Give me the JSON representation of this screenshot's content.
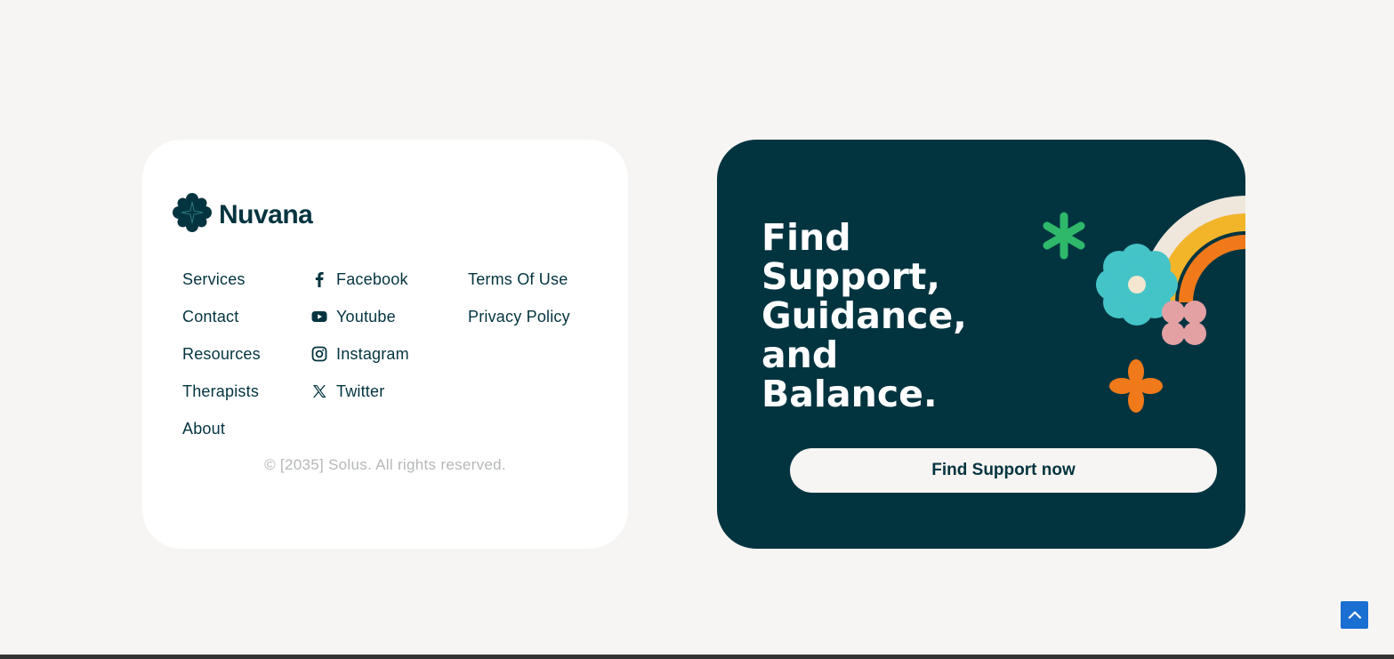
{
  "brand": {
    "name": "Nuvana"
  },
  "nav": {
    "col1": [
      {
        "label": "Services"
      },
      {
        "label": "Contact"
      },
      {
        "label": "Resources"
      },
      {
        "label": "Therapists"
      },
      {
        "label": "About"
      }
    ],
    "col2": [
      {
        "label": "Facebook",
        "icon": "facebook-icon"
      },
      {
        "label": "Youtube",
        "icon": "youtube-icon"
      },
      {
        "label": "Instagram",
        "icon": "instagram-icon"
      },
      {
        "label": "Twitter",
        "icon": "x-twitter-icon"
      }
    ],
    "col3": [
      {
        "label": "Terms Of Use"
      },
      {
        "label": "Privacy Policy"
      }
    ]
  },
  "copyright": "© [2035] Solus. All rights reserved.",
  "cta": {
    "heading_lines": [
      "Find",
      "Support,",
      "Guidance,",
      "and",
      "Balance."
    ],
    "button_label": "Find Support now"
  },
  "colors": {
    "brand_dark": "#023440",
    "page_bg": "#f7f5f3",
    "card_bg": "#ffffff",
    "accent_blue": "#1a6fd2",
    "flower_teal": "#45c4c8",
    "flower_green": "#2fb86a",
    "flower_orange": "#f07a1a",
    "flower_pink": "#e3a1a4",
    "rainbow_yellow": "#f2b429",
    "rainbow_cream": "#efe6dc"
  }
}
